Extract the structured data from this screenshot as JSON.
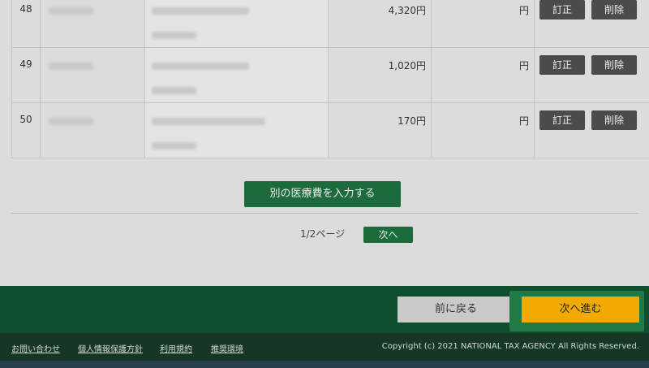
{
  "table": {
    "rows": [
      {
        "no": "48",
        "amount": "4,320円",
        "amount2": "円",
        "correct_label": "訂正",
        "delete_label": "削除"
      },
      {
        "no": "49",
        "amount": "1,020円",
        "amount2": "円",
        "correct_label": "訂正",
        "delete_label": "削除"
      },
      {
        "no": "50",
        "amount": "170円",
        "amount2": "円",
        "correct_label": "訂正",
        "delete_label": "削除"
      }
    ]
  },
  "add_button_label": "別の医療費を入力する",
  "pagination": {
    "page_label": "1/2ページ",
    "next_label": "次へ"
  },
  "actions": {
    "back_label": "前に戻る",
    "next_label": "次へ進む"
  },
  "footer": {
    "links": [
      "お問い合わせ",
      "個人情報保護方針",
      "利用規約",
      "推奨環境"
    ],
    "copyright": "Copyright (c) 2021 NATIONAL TAX AGENCY All Rights Reserved."
  },
  "colors": {
    "primary_green": "#1c6b3c",
    "action_bar": "#0f4f2d",
    "footer": "#163725",
    "next_accent": "#f2a900"
  }
}
